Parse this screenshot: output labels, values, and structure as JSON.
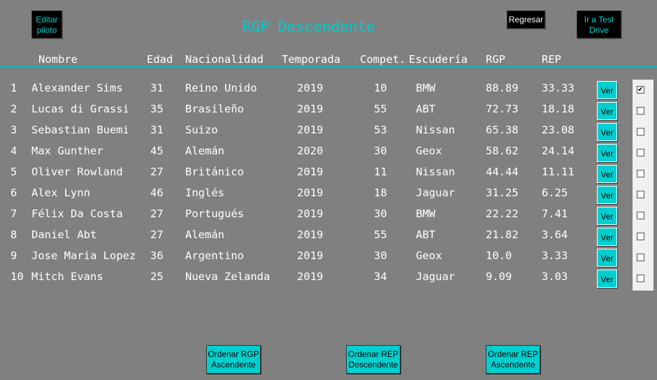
{
  "title": "RGP Descendente",
  "top_buttons": {
    "edit_pilot": "Editar piloto",
    "back": "Regresar",
    "test_drive": "Ir a Test Drive"
  },
  "headers": [
    "Nombre",
    "Edad",
    "Nacionalidad",
    "Temporada",
    "Compet.",
    "Escudería",
    "RGP",
    "REP"
  ],
  "rows": [
    {
      "n": "1",
      "name": "Alexander Sims",
      "age": "31",
      "nat": "Reino Unido",
      "season": "2019",
      "comp": "10",
      "team": "BMW",
      "rgp": "88.89",
      "rep": "33.33",
      "checked": true
    },
    {
      "n": "2",
      "name": "Lucas di Grassi",
      "age": "35",
      "nat": "Brasileño",
      "season": "2019",
      "comp": "55",
      "team": "ABT",
      "rgp": "72.73",
      "rep": "18.18",
      "checked": false
    },
    {
      "n": "3",
      "name": "Sebastian Buemi",
      "age": "31",
      "nat": "Suizo",
      "season": "2019",
      "comp": "53",
      "team": "Nissan",
      "rgp": "65.38",
      "rep": "23.08",
      "checked": false
    },
    {
      "n": "4",
      "name": "Max Gunther",
      "age": "45",
      "nat": "Alemán",
      "season": "2020",
      "comp": "30",
      "team": "Geox",
      "rgp": "58.62",
      "rep": "24.14",
      "checked": false
    },
    {
      "n": "5",
      "name": "Oliver Rowland",
      "age": "27",
      "nat": "Británico",
      "season": "2019",
      "comp": "11",
      "team": "Nissan",
      "rgp": "44.44",
      "rep": "11.11",
      "checked": false
    },
    {
      "n": "6",
      "name": "Alex Lynn",
      "age": "46",
      "nat": "Inglés",
      "season": "2019",
      "comp": "18",
      "team": "Jaguar",
      "rgp": "31.25",
      "rep": "6.25",
      "checked": false
    },
    {
      "n": "7",
      "name": "Félix Da Costa",
      "age": "27",
      "nat": "Portugués",
      "season": "2019",
      "comp": "30",
      "team": "BMW",
      "rgp": "22.22",
      "rep": "7.41",
      "checked": false
    },
    {
      "n": "8",
      "name": "Daniel Abt",
      "age": "27",
      "nat": "Alemán",
      "season": "2019",
      "comp": "55",
      "team": "ABT",
      "rgp": "21.82",
      "rep": "3.64",
      "checked": false
    },
    {
      "n": "9",
      "name": "Jose Maria Lopez",
      "age": "36",
      "nat": "Argentino",
      "season": "2019",
      "comp": "30",
      "team": "Geox",
      "rgp": "10.0",
      "rep": "3.33",
      "checked": false
    },
    {
      "n": "10",
      "name": "Mitch Evans",
      "age": "25",
      "nat": "Nueva Zelanda",
      "season": "2019",
      "comp": "34",
      "team": "Jaguar",
      "rgp": "9.09",
      "rep": "3.03",
      "checked": false
    }
  ],
  "ver_label": "Ver",
  "bottom_buttons": {
    "rgp_asc": "Ordenar RGP Ascendente",
    "rep_desc": "Ordenar REP Descendente",
    "rep_asc": "Ordenar REP Ascendente"
  },
  "colors": {
    "background": "#808080",
    "accent": "#00cfcf",
    "title": "#00cccc"
  }
}
